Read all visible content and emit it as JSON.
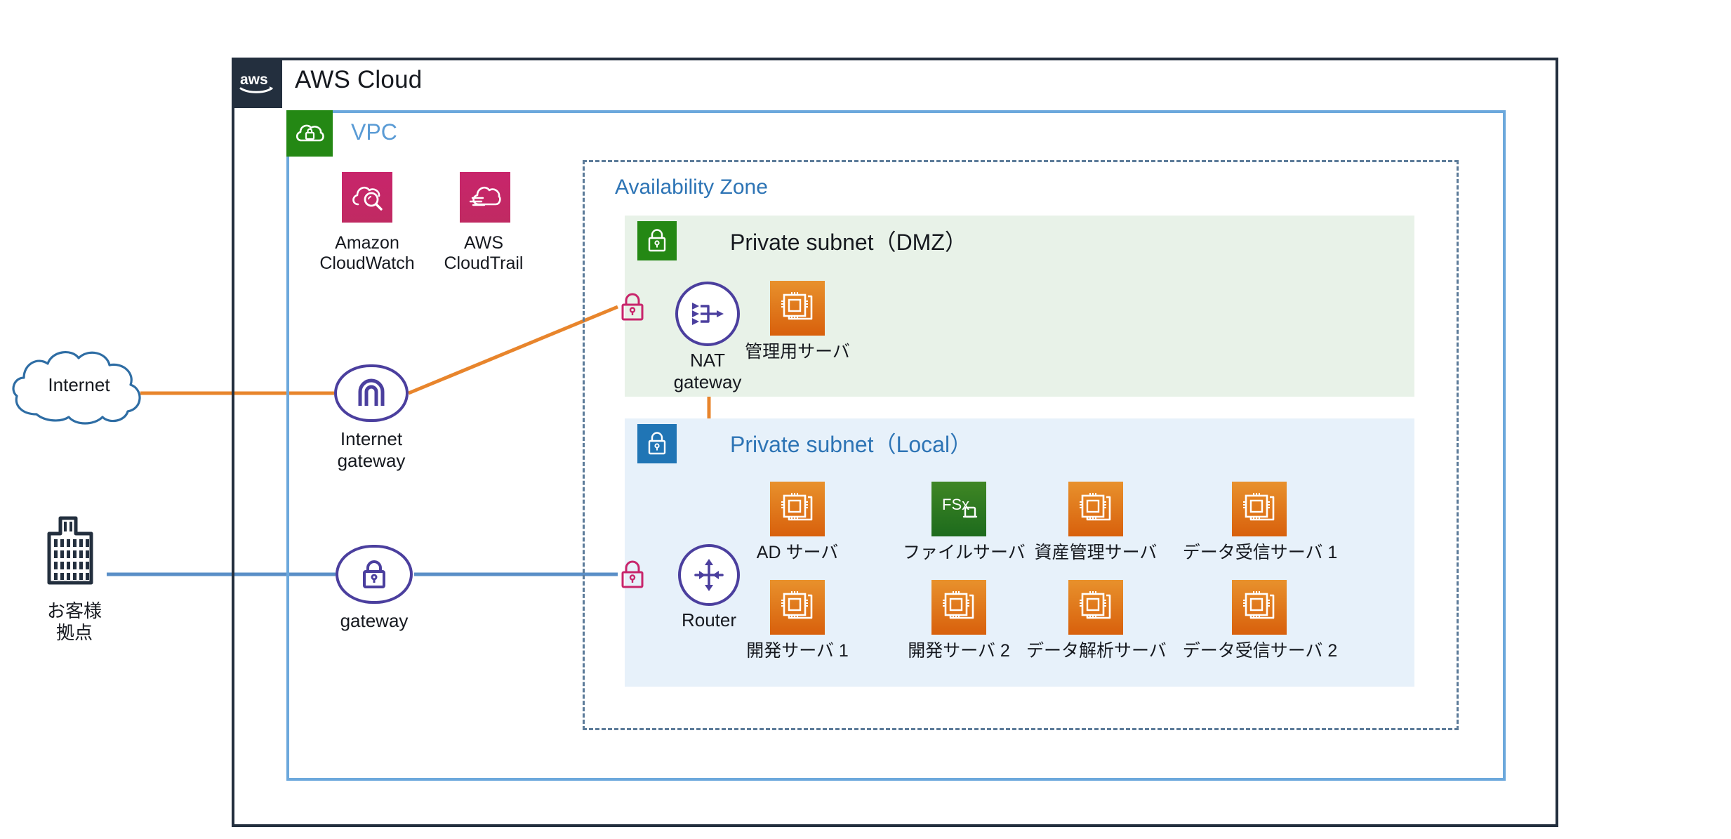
{
  "diagram": {
    "cloud_title": "AWS Cloud",
    "vpc_title": "VPC",
    "az_title": "Availability Zone",
    "dmz_title": "Private subnet（DMZ）",
    "local_title": "Private subnet（Local）"
  },
  "external": {
    "internet_label": "Internet",
    "onprem_label_line1": "お客様",
    "onprem_label_line2": "拠点"
  },
  "vpc_services": [
    {
      "name": "Amazon CloudWatch",
      "label_line1": "Amazon",
      "label_line2": "CloudWatch",
      "icon": "cloudwatch-icon",
      "color": "#c8256b"
    },
    {
      "name": "AWS CloudTrail",
      "label_line1": "AWS",
      "label_line2": "CloudTrail",
      "icon": "cloudtrail-icon",
      "color": "#c8256b"
    }
  ],
  "gateways": [
    {
      "name": "internet-gateway",
      "label_line1": "Internet",
      "label_line2": "gateway",
      "icon": "internet-gateway-icon"
    },
    {
      "name": "vpn-gateway",
      "label_line1": "gateway",
      "label_line2": "",
      "icon": "vpn-gateway-lock-icon"
    },
    {
      "name": "nat-gateway",
      "label_line1": "NAT",
      "label_line2": "gateway",
      "icon": "nat-gateway-icon"
    },
    {
      "name": "router",
      "label_line1": "Router",
      "label_line2": "",
      "icon": "router-icon"
    }
  ],
  "dmz_instances": [
    {
      "label": "管理用サーバ",
      "icon": "ec2-instance-icon",
      "color": "#e8912c"
    }
  ],
  "local_instances_row1": [
    {
      "label": "AD サーバ",
      "icon": "ec2-instance-icon",
      "color": "#e8912c"
    },
    {
      "label": "ファイルサーバ",
      "icon": "fsx-icon",
      "color": "#3f8624"
    },
    {
      "label": "資産管理サーバ",
      "icon": "ec2-instance-icon",
      "color": "#e8912c"
    },
    {
      "label": "データ受信サーバ 1",
      "icon": "ec2-instance-icon",
      "color": "#e8912c"
    }
  ],
  "local_instances_row2": [
    {
      "label": "開発サーバ 1",
      "icon": "ec2-instance-icon",
      "color": "#e8912c"
    },
    {
      "label": "開発サーバ 2",
      "icon": "ec2-instance-icon",
      "color": "#e8912c"
    },
    {
      "label": "データ解析サーバ",
      "icon": "ec2-instance-icon",
      "color": "#e8912c"
    },
    {
      "label": "データ受信サーバ 2",
      "icon": "ec2-instance-icon",
      "color": "#e8912c"
    }
  ],
  "colors": {
    "aws_navy": "#232f3e",
    "vpc_blue": "#6ca8dc",
    "vpc_green": "#248814",
    "az_dash": "#5c7b99",
    "dmz_fill": "#e8f2e8",
    "local_fill": "#e7f1fa",
    "local_badge": "#2075b5",
    "node_purple": "#4b3f9e",
    "lock_pink": "#c8256b",
    "wire_orange": "#e8852c",
    "wire_blue": "#5a8fc7",
    "title_blue": "#2d74b5"
  }
}
